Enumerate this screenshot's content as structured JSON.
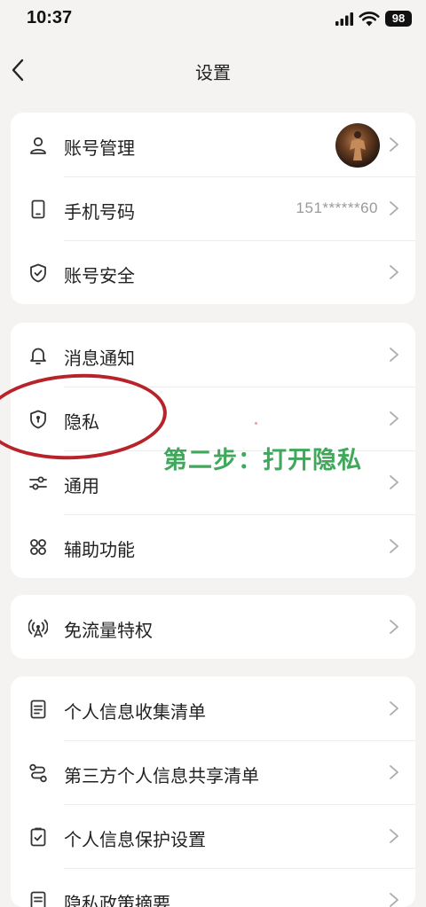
{
  "status": {
    "time": "10:37",
    "battery": "98"
  },
  "nav": {
    "title": "设置"
  },
  "groups": [
    {
      "items": [
        {
          "label": "账号管理",
          "icon": "person-icon",
          "value": "",
          "has_avatar": true
        },
        {
          "label": "手机号码",
          "icon": "phone-icon",
          "value": "151******60"
        },
        {
          "label": "账号安全",
          "icon": "shield-check-icon",
          "value": ""
        }
      ]
    },
    {
      "items": [
        {
          "label": "消息通知",
          "icon": "bell-icon",
          "value": ""
        },
        {
          "label": "隐私",
          "icon": "privacy-shield-icon",
          "value": ""
        },
        {
          "label": "通用",
          "icon": "sliders-icon",
          "value": ""
        },
        {
          "label": "辅助功能",
          "icon": "grid-icon",
          "value": ""
        }
      ]
    },
    {
      "items": [
        {
          "label": "免流量特权",
          "icon": "broadcast-icon",
          "value": ""
        }
      ]
    },
    {
      "items": [
        {
          "label": "个人信息收集清单",
          "icon": "document-icon",
          "value": ""
        },
        {
          "label": "第三方个人信息共享清单",
          "icon": "share-route-icon",
          "value": ""
        },
        {
          "label": "个人信息保护设置",
          "icon": "checklist-icon",
          "value": ""
        },
        {
          "label": "隐私政策摘要",
          "icon": "document-icon",
          "value": ""
        }
      ]
    }
  ],
  "annotation": {
    "text": "第二步：打开隐私",
    "highlight_color": "#b8232a",
    "text_color": "#3fa85a"
  }
}
